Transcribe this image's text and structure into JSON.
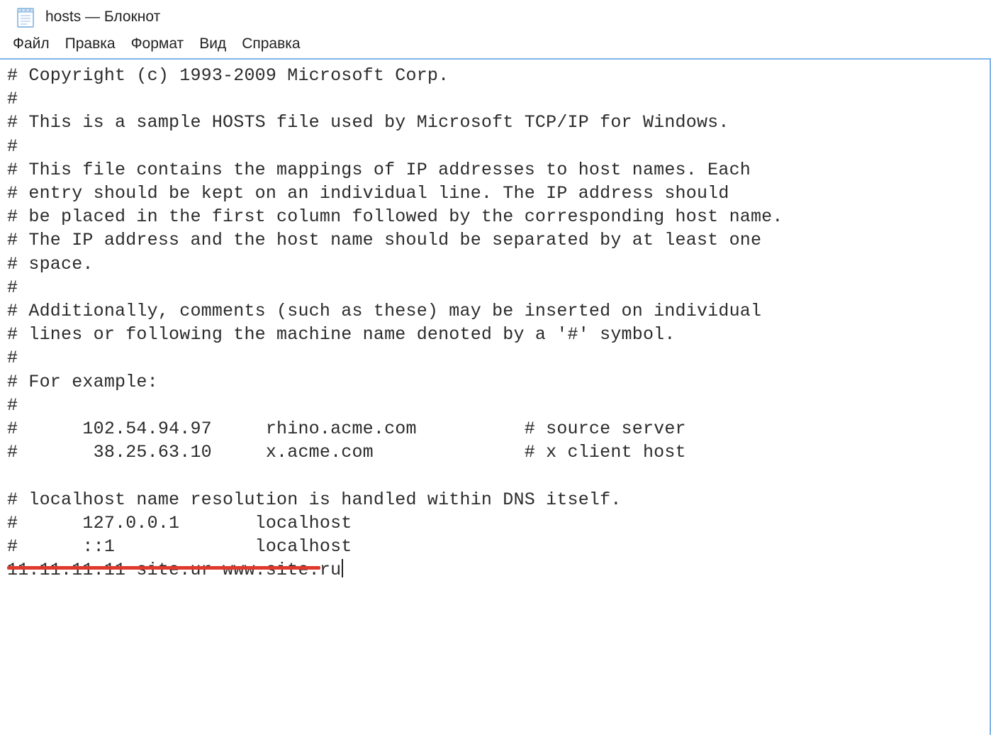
{
  "window": {
    "title": "hosts — Блокнот"
  },
  "menu": {
    "items": [
      {
        "label": "Файл"
      },
      {
        "label": "Правка"
      },
      {
        "label": "Формат"
      },
      {
        "label": "Вид"
      },
      {
        "label": "Справка"
      }
    ]
  },
  "editor": {
    "content": "# Copyright (c) 1993-2009 Microsoft Corp.\n#\n# This is a sample HOSTS file used by Microsoft TCP/IP for Windows.\n#\n# This file contains the mappings of IP addresses to host names. Each\n# entry should be kept on an individual line. The IP address should\n# be placed in the first column followed by the corresponding host name.\n# The IP address and the host name should be separated by at least one\n# space.\n#\n# Additionally, comments (such as these) may be inserted on individual\n# lines or following the machine name denoted by a '#' symbol.\n#\n# For example:\n#\n#      102.54.94.97     rhino.acme.com          # source server\n#       38.25.63.10     x.acme.com              # x client host\n\n# localhost name resolution is handled within DNS itself.\n#      127.0.0.1       localhost\n#      ::1             localhost\n11.11.11.11 site.ur www.site.ru"
  },
  "annotation": {
    "underline_color": "#e0382b"
  }
}
